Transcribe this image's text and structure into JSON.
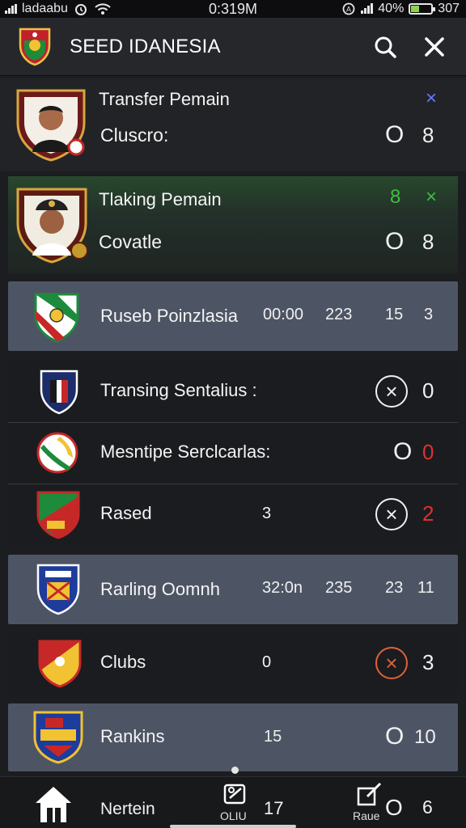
{
  "status_bar": {
    "carrier": "ladaabu",
    "time": "0:319M",
    "battery_percent": "40%",
    "battery_level": 0.4,
    "extra": "307"
  },
  "header": {
    "title": "SEED IDANESIA",
    "search_icon": "search-icon",
    "close_icon": "close-icon"
  },
  "rows": [
    {
      "title": "Transfer Pemain",
      "subtitle": "Cluscro:",
      "mark": "×",
      "a": "O",
      "b": "8"
    },
    {
      "title": "Tlaking Pemain",
      "subtitle": "Covatle",
      "mark": "×",
      "top_value": "8",
      "a": "O",
      "b": "8"
    },
    {
      "label": "Ruseb Poinzlasia",
      "c1": "00:00",
      "c2": "223",
      "c3": "15",
      "c4": "3"
    },
    {
      "label": "Transing Sentalius :",
      "x": "×",
      "v": "0"
    },
    {
      "label": "Mesntipe Serclcarlas:",
      "a": "O",
      "v": "0"
    },
    {
      "label": "Rased",
      "c1": "3",
      "x": "×",
      "v": "2"
    },
    {
      "label": "Rarling Oomnh",
      "c1": "32:0n",
      "c2": "235",
      "c3": "23",
      "c4": "11"
    },
    {
      "label": "Clubs",
      "c1": "0",
      "x": "×",
      "v": "3"
    },
    {
      "label": "Rankins",
      "c1": "15",
      "a": "O",
      "v": "10"
    }
  ],
  "bottom_nav": {
    "home_label": "Nertein",
    "tab2_label": "OLIU",
    "tab2_value": "17",
    "tab3_label": "Raue",
    "tab3_a": "O",
    "tab3_value": "6"
  },
  "colors": {
    "accent_green": "#3fbf3f",
    "accent_red": "#e03030",
    "accent_blue": "#5b7cff"
  }
}
